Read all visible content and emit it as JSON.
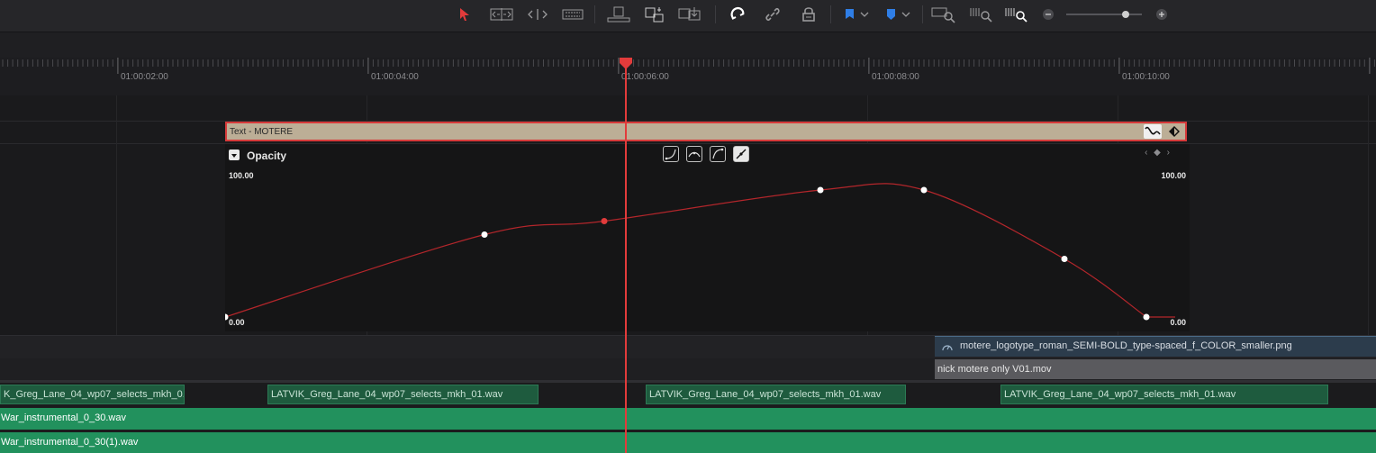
{
  "toolbar": {
    "icons": [
      "selection-arrow-icon",
      "trim-edit-icon",
      "dynamic-trim-icon",
      "blade-icon",
      "insert-clip-icon",
      "overwrite-clip-icon",
      "replace-clip-icon",
      "snapping-icon",
      "linked-selection-icon",
      "position-lock-icon",
      "flag-icon",
      "marker-icon",
      "zoom-full-icon",
      "zoom-detail-icon",
      "zoom-custom-icon",
      "zoom-out-icon",
      "zoom-slider",
      "zoom-in-icon"
    ],
    "accent_selected": "#e23b3b",
    "flag_color": "#2f7ee6",
    "marker_color": "#2f7ee6"
  },
  "ruler": {
    "timecodes": [
      "01:00:02:00",
      "01:00:04:00",
      "01:00:06:00",
      "01:00:08:00",
      "01:00:10:00"
    ]
  },
  "text_clip": {
    "label": "Text - MOTERE"
  },
  "curve_panel": {
    "parameter": "Opacity",
    "max_label_left": "100.00",
    "max_label_right": "100.00",
    "min_label_left": "0.00",
    "min_label_right": "0.00",
    "ease_buttons": [
      "ease-in-icon",
      "ease-in-out-icon",
      "ease-out-icon",
      "linear-icon"
    ],
    "active_ease": "linear-icon",
    "nav": "‹ ◆ ›",
    "curve_color": "#b3262b",
    "keyframe_values": [
      0,
      61,
      71,
      94,
      94,
      43,
      0
    ],
    "selected_keyframe_index": 2
  },
  "tracks": {
    "image_clip": "motere_logotype_roman_SEMI-BOLD_type-spaced_f_COLOR_smaller.png",
    "video_clip": "nick motere only V01.mov",
    "audio_clips": [
      "K_Greg_Lane_04_wp07_selects_mkh_0...",
      "LATVIK_Greg_Lane_04_wp07_selects_mkh_01.wav",
      "LATVIK_Greg_Lane_04_wp07_selects_mkh_01.wav",
      "LATVIK_Greg_Lane_04_wp07_selects_mkh_01.wav"
    ],
    "music_track_1": "War_instrumental_0_30.wav",
    "music_track_2": "War_instrumental_0_30(1).wav"
  },
  "playhead": {
    "color": "#e23b3b"
  }
}
